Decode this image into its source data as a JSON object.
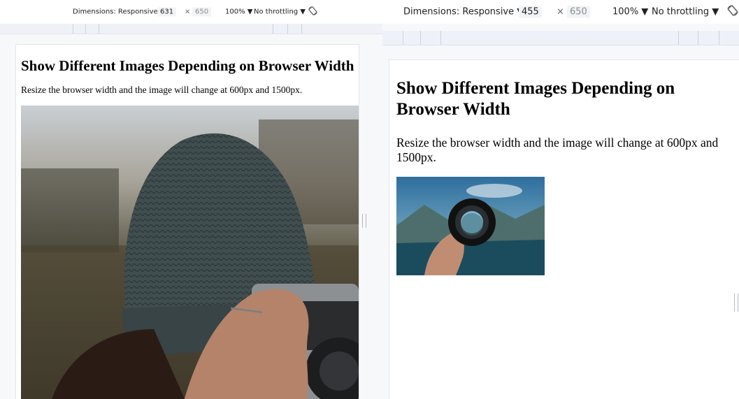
{
  "left": {
    "toolbar": {
      "dimensions_label": "Dimensions: Responsive ▼",
      "width_value": "631",
      "times": "×",
      "height_value": "650",
      "zoom_label": "100% ▼",
      "throttling_label": "No throttling ▼"
    },
    "page": {
      "heading": "Show Different Images Depending on Browser Width",
      "description": "Resize the browser width and the image will change at 600px and 1500px."
    },
    "image": {
      "icon": "photo-person-beanie-camera"
    }
  },
  "right": {
    "toolbar": {
      "dimensions_label": "Dimensions: Responsive ▼",
      "width_value": "455",
      "times": "×",
      "height_value": "650",
      "zoom_label": "100% ▼",
      "throttling_label": "No throttling ▼"
    },
    "page": {
      "heading": "Show Different Images Depending on Browser Width",
      "description": "Resize the browser width and the image will change at 600px and 1500px."
    },
    "image": {
      "icon": "photo-hand-holding-lens"
    }
  }
}
